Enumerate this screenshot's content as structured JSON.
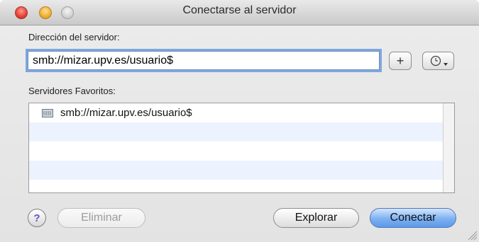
{
  "window": {
    "title": "Conectarse al servidor"
  },
  "server": {
    "label": "Dirección del servidor:",
    "value": "smb://mizar.upv.es/usuario$"
  },
  "favorites": {
    "label": "Servidores Favoritos:",
    "items": [
      {
        "label": "smb://mizar.upv.es/usuario$",
        "icon": "server-icon"
      }
    ]
  },
  "buttons": {
    "add_label": "+",
    "help_label": "?",
    "remove_label": "Eliminar",
    "browse_label": "Explorar",
    "connect_label": "Conectar"
  },
  "colors": {
    "focus_ring": "#7ea7e0",
    "default_button": "#5d9ae7",
    "list_alt_row": "#edf3fe"
  }
}
